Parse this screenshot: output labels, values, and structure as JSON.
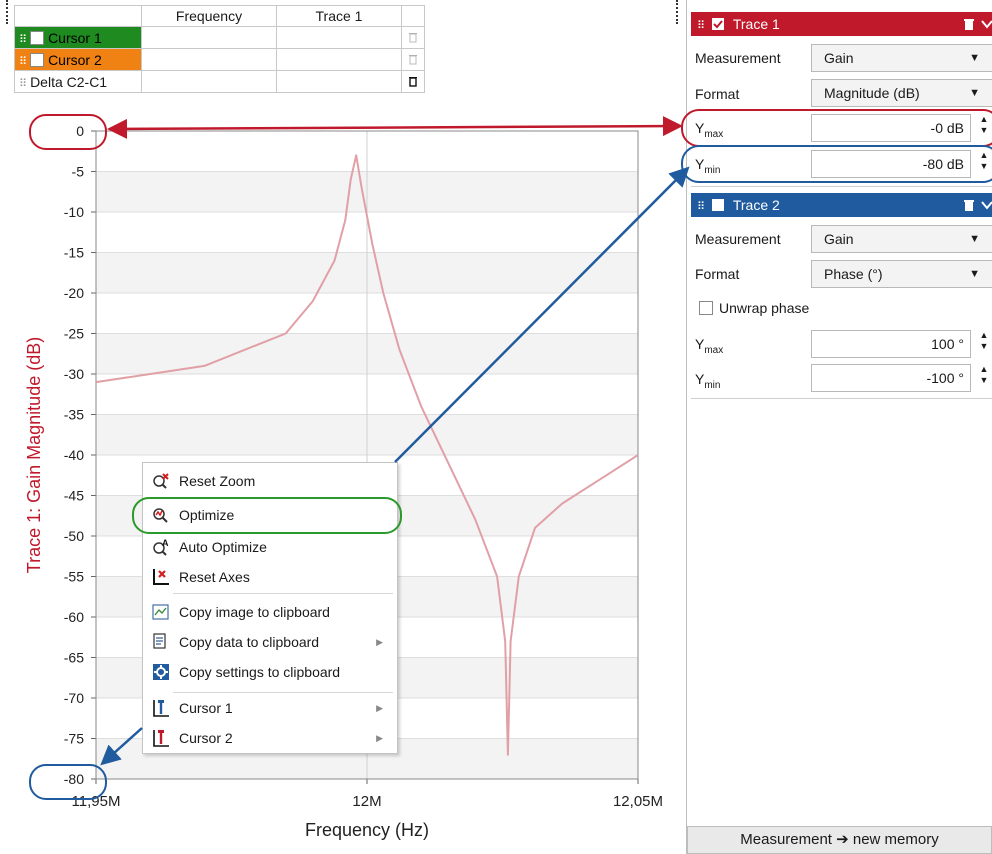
{
  "cursor_table": {
    "headers": [
      "",
      "Frequency",
      "Trace 1"
    ],
    "rows": [
      {
        "label": "Cursor 1",
        "color": "#1f8a1f"
      },
      {
        "label": "Cursor 2",
        "color": "#f08214"
      },
      {
        "label": "Delta C2-C1",
        "color": ""
      }
    ]
  },
  "chart_data": {
    "type": "line",
    "ylabel": "Trace 1: Gain Magnitude (dB)",
    "xlabel": "Frequency (Hz)",
    "ylim": [
      -80,
      0
    ],
    "xlim": [
      11950000,
      12050000
    ],
    "yticks": [
      "0",
      "-5",
      "-10",
      "-15",
      "-20",
      "-25",
      "-30",
      "-35",
      "-40",
      "-45",
      "-50",
      "-55",
      "-60",
      "-65",
      "-70",
      "-75",
      "-80"
    ],
    "xticks": [
      "11,95M",
      "12M",
      "12,05M"
    ],
    "line_color": "#e0a0a6",
    "series": [
      {
        "x": [
          11950000,
          11970000,
          11985000,
          11990000,
          11994000,
          11996000,
          11997000,
          11998000,
          11999000,
          12001000,
          12003000,
          12006000,
          12010000,
          12015000,
          12020000,
          12024000,
          12025500,
          12026000,
          12026500,
          12028000,
          12031000,
          12036000,
          12043000,
          12050000
        ],
        "y": [
          -31,
          -29,
          -25,
          -21,
          -16,
          -11,
          -6,
          -3,
          -7,
          -14,
          -20,
          -27,
          -34,
          -41,
          -48,
          -55,
          -63,
          -77,
          -63,
          -55,
          -49,
          -46,
          -43,
          -40
        ]
      }
    ]
  },
  "context_menu": {
    "items": [
      {
        "label": "Reset Zoom",
        "icon": "reset-zoom-icon"
      },
      {
        "label": "Optimize",
        "icon": "optimize-icon"
      },
      {
        "label": "Auto Optimize",
        "icon": "auto-optimize-icon"
      },
      {
        "label": "Reset Axes",
        "icon": "reset-axes-icon"
      },
      {
        "label": "Copy image to clipboard",
        "icon": "copy-image-icon"
      },
      {
        "label": "Copy data to clipboard",
        "icon": "copy-data-icon"
      },
      {
        "label": "Copy settings to clipboard",
        "icon": "copy-settings-icon"
      },
      {
        "label": "Cursor 1",
        "icon": "cursor1-icon"
      },
      {
        "label": "Cursor 2",
        "icon": "cursor2-icon"
      }
    ]
  },
  "trace1": {
    "title": "Trace 1",
    "color": "#c0192c",
    "checked": true,
    "measurement_label": "Measurement",
    "measurement_value": "Gain",
    "format_label": "Format",
    "format_value": "Magnitude (dB)",
    "ymax_label": "Y",
    "ymax_sub": "max",
    "ymax_value": "-0 dB",
    "ymin_label": "Y",
    "ymin_sub": "min",
    "ymin_value": "-80 dB"
  },
  "trace2": {
    "title": "Trace 2",
    "color": "#1f5b9e",
    "checked": false,
    "measurement_label": "Measurement",
    "measurement_value": "Gain",
    "format_label": "Format",
    "format_value": "Phase (°)",
    "unwrap_label": "Unwrap phase",
    "ymax_label": "Y",
    "ymax_sub": "max",
    "ymax_value": "100 °",
    "ymin_label": "Y",
    "ymin_sub": "min",
    "ymin_value": "-100 °"
  },
  "footer_button": "Measurement ➔ new memory",
  "annotation_colors": {
    "red": "#c0192c",
    "blue": "#1f5b9e",
    "green": "#2a9a2a"
  }
}
